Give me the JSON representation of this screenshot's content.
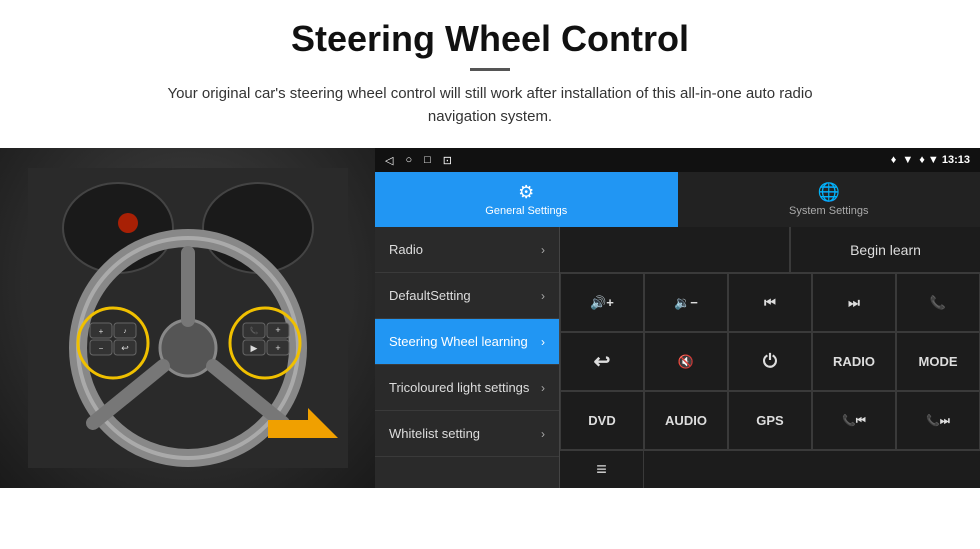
{
  "header": {
    "title": "Steering Wheel Control",
    "subtitle": "Your original car's steering wheel control will still work after installation of this all-in-one auto radio navigation system."
  },
  "status_bar": {
    "nav_icons": [
      "◁",
      "○",
      "□",
      "⊡"
    ],
    "right": "♦ ▼  13:13"
  },
  "tabs": [
    {
      "id": "general",
      "label": "General Settings",
      "icon": "⚙",
      "active": true
    },
    {
      "id": "system",
      "label": "System Settings",
      "icon": "🌐",
      "active": false
    }
  ],
  "menu_items": [
    {
      "id": "radio",
      "label": "Radio",
      "active": false
    },
    {
      "id": "default",
      "label": "DefaultSetting",
      "active": false
    },
    {
      "id": "steering",
      "label": "Steering Wheel learning",
      "active": true
    },
    {
      "id": "tricoloured",
      "label": "Tricoloured light settings",
      "active": false
    },
    {
      "id": "whitelist",
      "label": "Whitelist setting",
      "active": false
    }
  ],
  "controls": {
    "begin_learn": "Begin learn",
    "grid_buttons": [
      {
        "id": "vol-up",
        "label": "🔊+",
        "type": "icon"
      },
      {
        "id": "vol-down",
        "label": "🔉−",
        "type": "icon"
      },
      {
        "id": "prev",
        "label": "⏮",
        "type": "icon"
      },
      {
        "id": "next",
        "label": "⏭",
        "type": "icon"
      },
      {
        "id": "phone",
        "label": "📞",
        "type": "icon"
      },
      {
        "id": "hook",
        "label": "↩",
        "type": "icon"
      },
      {
        "id": "mute",
        "label": "🔇",
        "type": "icon"
      },
      {
        "id": "power",
        "label": "⏻",
        "type": "icon"
      },
      {
        "id": "radio-btn",
        "label": "RADIO",
        "type": "text"
      },
      {
        "id": "mode",
        "label": "MODE",
        "type": "text"
      },
      {
        "id": "dvd",
        "label": "DVD",
        "type": "text"
      },
      {
        "id": "audio",
        "label": "AUDIO",
        "type": "text"
      },
      {
        "id": "gps",
        "label": "GPS",
        "type": "text"
      },
      {
        "id": "tel-prev",
        "label": "📞⏮",
        "type": "icon"
      },
      {
        "id": "tel-next",
        "label": "📞⏭",
        "type": "icon"
      }
    ],
    "bottom_icon": "≡"
  }
}
